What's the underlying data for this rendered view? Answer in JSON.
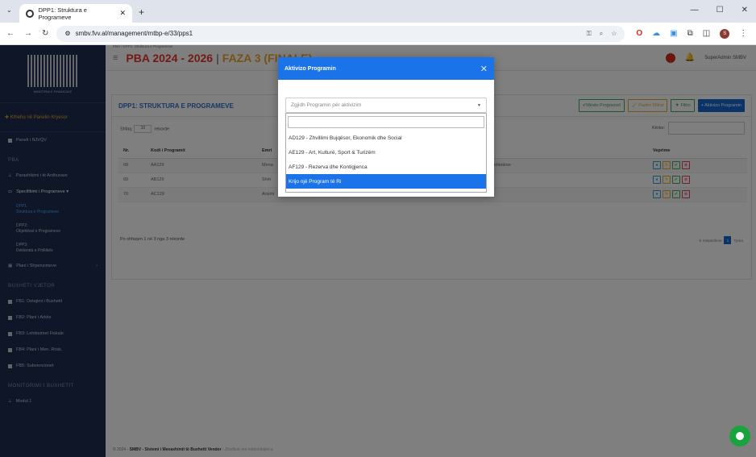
{
  "browser": {
    "tab_title": "DPP1: Struktura e Programeve",
    "url": "smbv.fvv.al/management/mtbp-e/33/pps1"
  },
  "sidebar": {
    "back_label": "Kthehu në Panelin Kryesor",
    "panel_label": "Paneli i NJVQV",
    "pba_section": "PBA",
    "items": [
      "Parashikimi i të Ardhurave",
      "Specifikimi i Programeve ▾"
    ],
    "subitems": [
      {
        "code": "DPP1:",
        "label": "Struktura e Programeve"
      },
      {
        "code": "DPP2:",
        "label": "Objektivat e Programeve"
      },
      {
        "code": "DPP3:",
        "label": "Deklarata e Politikës"
      }
    ],
    "plan_label": "Plani i Shpenzimeve",
    "budget_section": "BUXHETI VJETOR",
    "budget_items": [
      "FB1: Detajimi i Buxhetit",
      "FB2: Plani i Arkës",
      "FB3: Lehtësimet Fiskale",
      "FB4: Plani i Men. Rrisk.",
      "FB5: Subvencionet"
    ],
    "monitor_section": "MONITORIMI I BUXHETIT",
    "monitor_items": [
      "Modul 1"
    ]
  },
  "topbar": {
    "title_main": "PBA 2024 - 2026",
    "sep": "|",
    "title_phase": "FAZA 3 (FINALE)",
    "user": "SuperAdmin SMBV"
  },
  "breadcrumb": "PBA / DPP1: Struktura e Programeve",
  "card": {
    "title": "DPP1: STRUKTURA E PROGRAMEVE",
    "btn_approve": "✔Mirato Programet",
    "btn_clear": "Pastro Filtrat",
    "btn_filter": "Filtro",
    "btn_activate": "+ Aktivizo Programin",
    "show_pre": "Shfaq",
    "show_val": "10",
    "show_post": "rekorde",
    "search_label": "Kërko:",
    "columns": [
      "Nr.",
      "Kodi i Programit",
      "Emri",
      "Programit",
      "Veprime"
    ],
    "rows": [
      [
        "68",
        "AA129",
        "Mena",
        "dhe Shërbimet Mbështetëse"
      ],
      [
        "69",
        "AB129",
        "Shër",
        "blike Komunitare"
      ],
      [
        "70",
        "AC129",
        "Arsimi",
        "Arsimi"
      ]
    ],
    "info": "Po shfaqen 1 në 3 nga 3 rekorde",
    "prev": "E mëparshme",
    "page": "1",
    "next": "Tjetra"
  },
  "footer": {
    "year": "© 2024 - ",
    "brand": "SMBV - Sistemi i Menaxhimit të Buxhetit Vendor",
    "dev": " - Zhvilluar me mbështetjen e"
  },
  "modal": {
    "title": "Aktivizo Programin",
    "placeholder": "Zgjidh Programin për aktivizim",
    "options": [
      "AD129 - Zhvillimi Bujqësor, Ekonomik dhe Social",
      "AE129 - Art, Kulturë, Sport & Turizëm",
      "AF129 - Rezerva dhe Kontigjenca",
      "Krijo një Program të Ri"
    ]
  }
}
